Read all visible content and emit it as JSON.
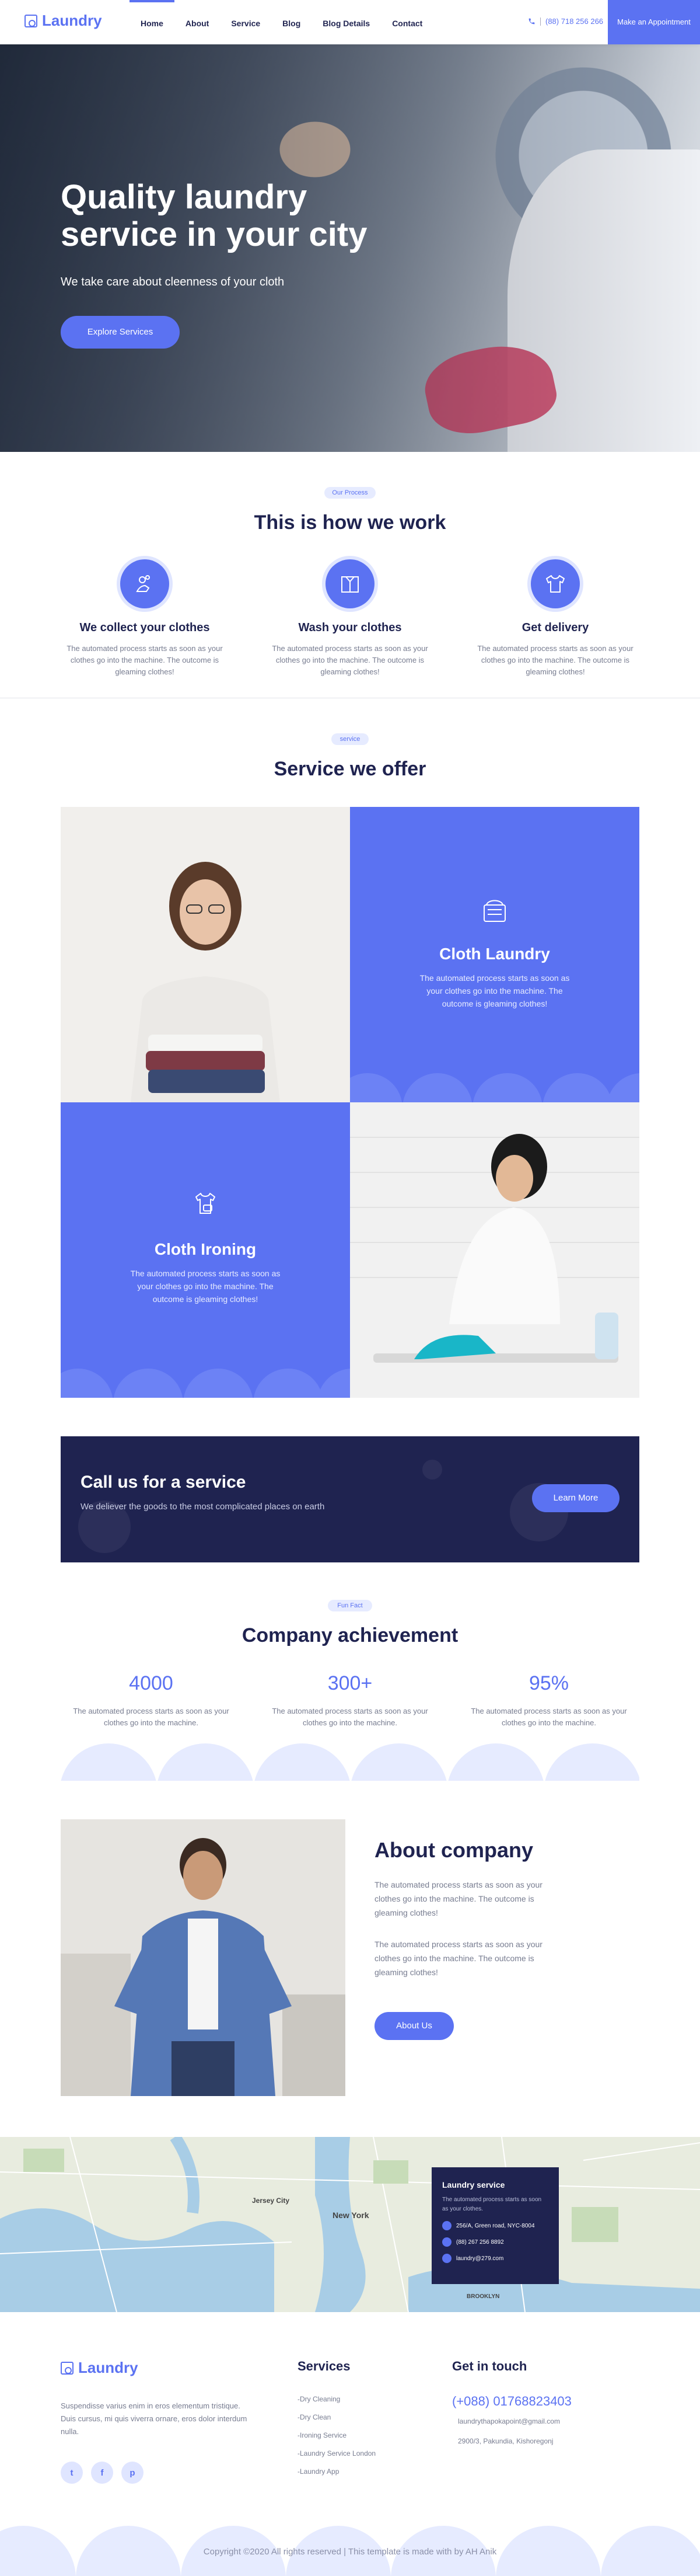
{
  "nav": {
    "logo": "Laundry",
    "menu": [
      "Home",
      "About",
      "Service",
      "Blog",
      "Blog Details",
      "Contact"
    ],
    "active": "Home",
    "phone": "(88) 718 256 266",
    "cta": "Make an Appointment"
  },
  "hero": {
    "title": "Quality laundry service in your city",
    "subtitle": "We take care about cleenness of your cloth",
    "button": "Explore Services"
  },
  "process": {
    "pill": "Our Process",
    "title": "This is how we work",
    "items": [
      {
        "title": "We collect your clothes",
        "text": "The automated process starts as soon as your clothes go into the machine. The outcome is gleaming clothes!",
        "icon": "washing-hands-icon"
      },
      {
        "title": "Wash your clothes",
        "text": "The automated process starts as soon as your clothes go into the machine. The outcome is gleaming clothes!",
        "icon": "shirt-box-icon"
      },
      {
        "title": "Get delivery",
        "text": "The automated process starts as soon as your clothes go into the machine. The outcome is gleaming clothes!",
        "icon": "tshirt-icon"
      }
    ]
  },
  "services": {
    "pill": "service",
    "title": "Service we offer",
    "cards": [
      {
        "title": "Cloth Laundry",
        "text": "The automated process starts as soon as your clothes go into the machine. The outcome is gleaming clothes!",
        "icon": "laundry-basket-icon"
      },
      {
        "title": "Cloth Ironing",
        "text": "The automated process starts as soon as your clothes go into the machine. The outcome is gleaming clothes!",
        "icon": "shirt-iron-icon"
      }
    ]
  },
  "call": {
    "title": "Call us for a service",
    "subtitle": "We deliever the goods to the most complicated places on earth",
    "button": "Learn More"
  },
  "achievement": {
    "pill": "Fun Fact",
    "title": "Company achievement",
    "stats": [
      {
        "value": "4000",
        "text": "The automated process starts as soon as your clothes go into the machine."
      },
      {
        "value": "300+",
        "text": "The automated process starts as soon as your clothes go into the machine."
      },
      {
        "value": "95%",
        "text": "The automated process starts as soon as your clothes go into the machine."
      }
    ]
  },
  "about": {
    "title": "About company",
    "p1": "The automated process starts as soon as your clothes go into the machine. The outcome is gleaming clothes!",
    "p2": "The automated process starts as soon as your clothes go into the machine. The outcome is gleaming clothes!",
    "button": "About Us"
  },
  "map": {
    "labels": [
      "Jersey City",
      "New York",
      "BROOKLYN"
    ],
    "card": {
      "title": "Laundry service",
      "text": "The automated process starts as soon as your clothes.",
      "address": "256/A, Green road, NYC-8004",
      "phone": "(88) 267 256 8892",
      "email": "laundry@279.com"
    }
  },
  "footer": {
    "logo": "Laundry",
    "text": "Suspendisse varius enim in eros elementum tristique. Duis cursus, mi quis viverra ornare, eros dolor interdum nulla.",
    "social": [
      "t",
      "f",
      "p"
    ],
    "services_title": "Services",
    "services": [
      "-Dry Cleaning",
      "-Dry Clean",
      "-Ironing Service",
      "-Laundry Service London",
      "-Laundry App"
    ],
    "contact_title": "Get in touch",
    "phone": "(+088) 01768823403",
    "email": "laundrythapokapoint@gmail.com",
    "address": "2900/3, Pakundia, Kishoregonj",
    "copyright": "Copyright ©2020 All rights reserved | This template is made with by AH Anik"
  },
  "colors": {
    "accent": "#5b72f2",
    "navy": "#1f2350",
    "soft": "#dfe5ff"
  }
}
